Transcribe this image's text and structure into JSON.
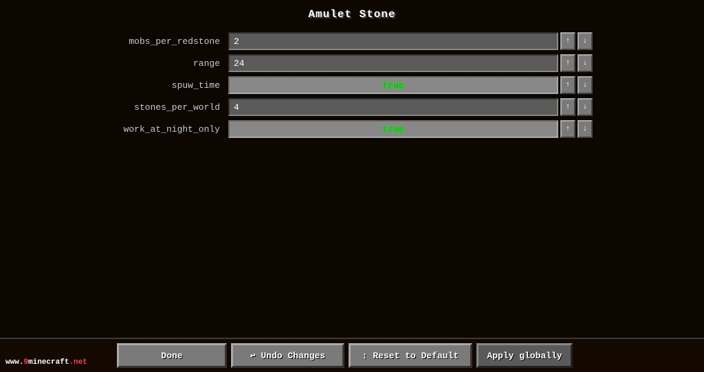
{
  "title": "Amulet Stone",
  "settings": [
    {
      "id": "mobs_per_redstone",
      "label": "mobs_per_redstone",
      "value": "2",
      "type": "text"
    },
    {
      "id": "range",
      "label": "range",
      "value": "24",
      "type": "text"
    },
    {
      "id": "spuw_time",
      "label": "spuw_time",
      "value": "true",
      "type": "toggle"
    },
    {
      "id": "stones_per_world",
      "label": "stones_per_world",
      "value": "4",
      "type": "text"
    },
    {
      "id": "work_at_night_only",
      "label": "work_at_night_only",
      "value": "true",
      "type": "toggle"
    }
  ],
  "buttons": {
    "done": "Done",
    "undo": "Undo Changes",
    "reset": "Reset to Default",
    "apply": "Apply globally"
  },
  "watermark": {
    "www": "www.",
    "nine": "9",
    "minecraft": "minecraft",
    "net": ".net"
  },
  "icons": {
    "undo": "↩",
    "reset": "↕",
    "arrow_up": "↑",
    "arrow_down": "↓"
  }
}
